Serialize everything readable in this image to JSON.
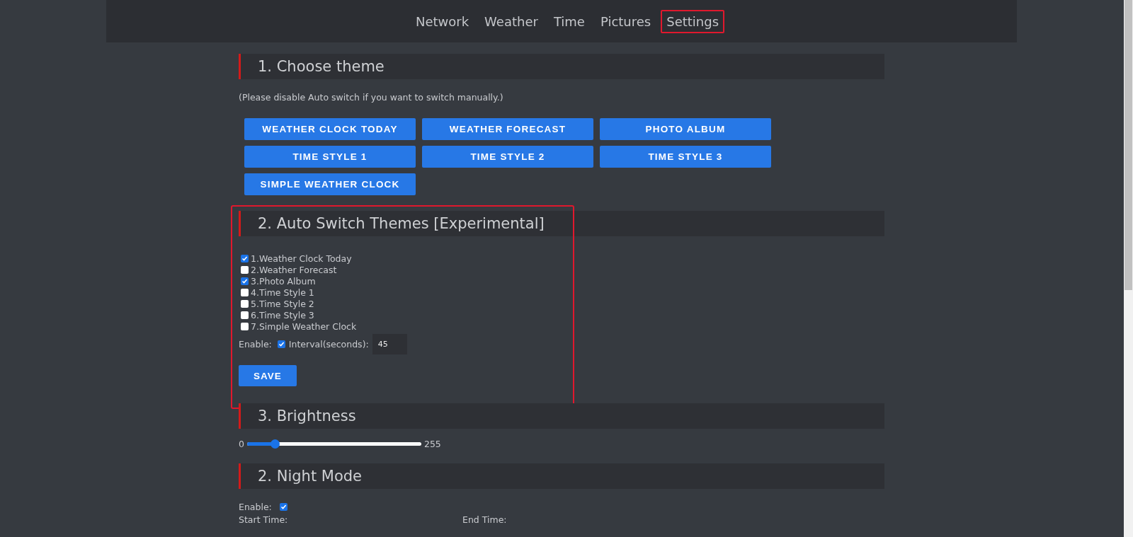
{
  "nav": {
    "tabs": [
      {
        "label": "Network",
        "selected": false
      },
      {
        "label": "Weather",
        "selected": false
      },
      {
        "label": "Time",
        "selected": false
      },
      {
        "label": "Pictures",
        "selected": false
      },
      {
        "label": "Settings",
        "selected": true
      }
    ]
  },
  "sections": [
    {
      "kind": "themes",
      "title": "1. Choose theme",
      "note": "(Please disable Auto switch if you want to switch manually.)",
      "buttons": [
        "WEATHER CLOCK TODAY",
        "WEATHER FORECAST",
        "PHOTO ALBUM",
        "TIME STYLE 1",
        "TIME STYLE 2",
        "TIME STYLE 3",
        "SIMPLE WEATHER CLOCK"
      ]
    },
    {
      "kind": "auto_switch",
      "title": "2. Auto Switch Themes [Experimental]",
      "highlighted": true,
      "themes": [
        {
          "label": "1.Weather Clock Today",
          "checked": true
        },
        {
          "label": "2.Weather Forecast",
          "checked": false
        },
        {
          "label": "3.Photo Album",
          "checked": true
        },
        {
          "label": "4.Time Style 1",
          "checked": false
        },
        {
          "label": "5.Time Style 2",
          "checked": false
        },
        {
          "label": "6.Time Style 3",
          "checked": false
        },
        {
          "label": "7.Simple Weather Clock",
          "checked": false
        }
      ],
      "enable_label": "Enable:",
      "enable_checked": true,
      "interval_label": "Interval(seconds):",
      "interval_value": "45",
      "save_label": "SAVE"
    },
    {
      "kind": "brightness",
      "title": "3. Brightness",
      "min_label": "0",
      "max_label": "255",
      "level": 0.16
    },
    {
      "kind": "night_mode",
      "title": "2. Night Mode",
      "enable_label": "Enable:",
      "enable_checked": true,
      "start_label": "Start Time:",
      "end_label": "End Time:"
    }
  ]
}
